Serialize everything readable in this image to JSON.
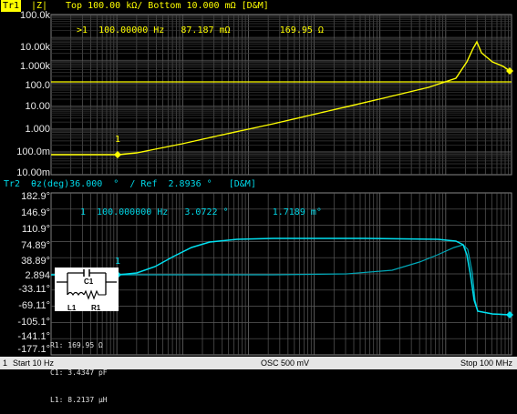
{
  "trace1": {
    "tab_label": "Tr1",
    "format": "|Z|",
    "scale_text": "Top 100.00 kΩ/ Bottom 10.000 mΩ [D&M]",
    "marker_readout": ">1  100.00000 Hz   87.187 mΩ         169.95 Ω",
    "y_labels": [
      "100.0k",
      "10.00k",
      "1.000k",
      "100.0",
      "10.00",
      "1.000",
      "100.0m",
      "10.00m"
    ],
    "marker_label": "1",
    "color": "#ffff00"
  },
  "trace2": {
    "tab_label": "Tr2",
    "header_text": "θz(deg)36.000  °  / Ref  2.8936 °   [D&M]",
    "marker_readout": "1  100.000000 Hz   3.0722 °        1.7189 m°",
    "y_labels": [
      "182.9°",
      "146.9°",
      "110.9°",
      "74.89°",
      "38.89°",
      "2.894",
      "-33.11°",
      "-69.11°",
      "-105.1°",
      "-141.1°",
      "-177.1°"
    ],
    "marker_label": "1",
    "color": "#00d8e8"
  },
  "equivalent_circuit": {
    "c_label": "C1",
    "l_label": "L1",
    "r_label": "R1",
    "values": [
      "R1: 169.95 Ω",
      "C1: 3.4347 pF",
      "L1: 8.2137 µH"
    ]
  },
  "status_bar": {
    "channel": "1",
    "start": "Start 10 Hz",
    "osc": "OSC 500 mV",
    "stop": "Stop  100 MHz"
  }
}
